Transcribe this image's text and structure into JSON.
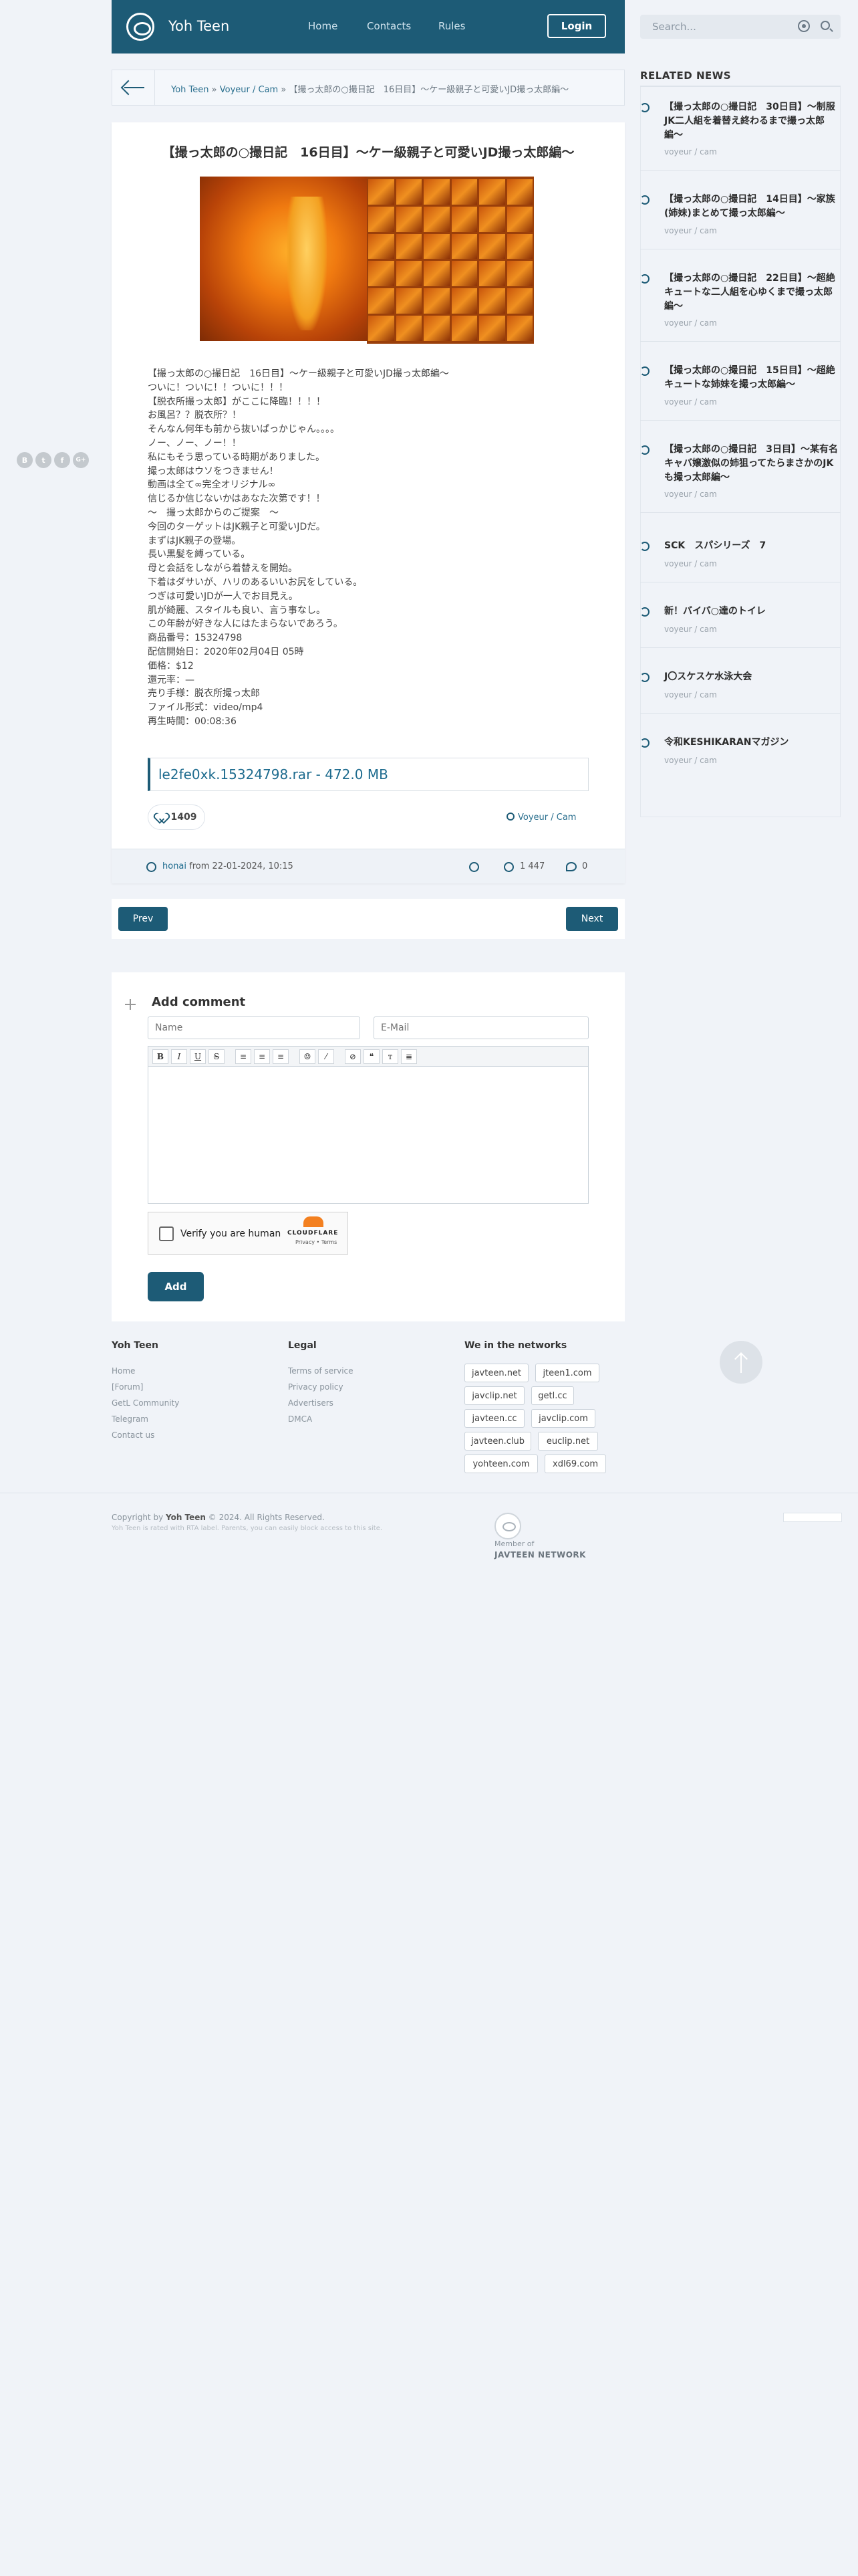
{
  "header": {
    "site_name": "Yoh Teen",
    "nav": [
      "Home",
      "Contacts",
      "Rules"
    ],
    "login": "Login",
    "search_placeholder": "Search...",
    "accent_color": "#1d5b76"
  },
  "breadcrumb": {
    "link1": "Yoh Teen",
    "sep1": " » ",
    "link2": "Voyeur / Cam",
    "sep2": " » ",
    "current": "【撮っ太郎の○撮日記　16日目】〜ケー級親子と可愛いJD撮っ太郎編〜"
  },
  "article": {
    "title": "【撮っ太郎の○撮日記　16日目】〜ケー級親子と可愛いJD撮っ太郎編〜",
    "body": "【撮っ太郎の○撮日記　16日目】〜ケー級親子と可愛いJD撮っ太郎編〜\nついに！ついに！！ついに！！！\n【脱衣所撮っ太郎】がここに降臨！！！！\nお風呂？？脱衣所？！\nそんなん何年も前から抜いぱっかじゃん。。。。\nノー、ノー、ノー！！\n私にもそう思っている時期がありました。\n撮っ太郎はウソをつきません！\n動画は全て∞完全オリジナル∞\n信じるか信じないかはあなた次第です！！\n〜　撮っ太郎からのご提案　〜\n今回のターゲットはJK親子と可愛いJDだ。\nまずはJK親子の登場。\n長い黒髪を縛っている。\n母と会話をしながら着替えを開始。\n下着はダサいが、ハリのあるいいお尻をしている。\nつぎは可愛いJDが一人でお目見え。\n肌が綺麗、スタイルも良い、言う事なし。\nこの年齢が好きな人にはたまらないであろう。\n商品番号：15324798\n配信開始日：2020年02月04日 05時\n価格：$12\n還元率：—\n売り手様：脱衣所撮っ太郎\nファイル形式：video/mp4\n再生時間：00:08:36",
    "download": "le2fe0xk.15324798.rar - 472.0 MB",
    "likes": "1409",
    "category": "Voyeur / Cam",
    "author": "honai",
    "date_text": " from 22-01-2024, 10:15",
    "views": "1 447",
    "comments": "0"
  },
  "pager": {
    "prev": "Prev",
    "next": "Next"
  },
  "comment_form": {
    "title": "Add comment",
    "name_placeholder": "Name",
    "email_placeholder": "E-Mail",
    "toolbar": [
      "B",
      "I",
      "U",
      "S",
      "≡",
      "≡",
      "≡",
      "☺",
      "⁄",
      "⊘",
      "❝",
      "ᴛ",
      "≣"
    ],
    "captcha_label": "Verify you are human",
    "captcha_brand": "CLOUDFLARE",
    "captcha_links": "Privacy • Terms",
    "submit": "Add"
  },
  "social": [
    "B",
    "t",
    "f",
    "G+"
  ],
  "sidebar": {
    "title": "RELATED NEWS",
    "items": [
      {
        "title": "【撮っ太郎の○撮日記　30日目】〜制服JK二人組を着替え終わるまで撮っ太郎編〜",
        "category": "voyeur / cam"
      },
      {
        "title": "【撮っ太郎の○撮日記　14日目】〜家族(姉妹)まとめて撮っ太郎編〜",
        "category": "voyeur / cam"
      },
      {
        "title": "【撮っ太郎の○撮日記　22日目】〜超絶キュートな二人組を心ゆくまで撮っ太郎編〜",
        "category": "voyeur / cam"
      },
      {
        "title": "【撮っ太郎の○撮日記　15日目】〜超絶キュートな姉妹を撮っ太郎編〜",
        "category": "voyeur / cam"
      },
      {
        "title": "【撮っ太郎の○撮日記　3日目】〜某有名キャバ嬢激似の姉狙ってたらまさかのJKも撮っ太郎編〜",
        "category": "voyeur / cam"
      },
      {
        "title": "SCK　スパシリーズ　7",
        "category": "voyeur / cam"
      },
      {
        "title": "新！バイバ○達のトイレ",
        "category": "voyeur / cam"
      },
      {
        "title": "J〇スケスケ水泳大会",
        "category": "voyeur / cam"
      },
      {
        "title": "令和KESHIKARANマガジン",
        "category": "voyeur / cam"
      }
    ]
  },
  "footer": {
    "col1_title": "Yoh Teen",
    "col1_links": [
      "Home",
      "[Forum]",
      "GetL Community",
      "Telegram",
      "Contact us"
    ],
    "col2_title": "Legal",
    "col2_links": [
      "Terms of service",
      "Privacy policy",
      "Advertisers",
      "DMCA"
    ],
    "col3_title": "We in the networks",
    "networks": [
      "javteen.net",
      "jteen1.com",
      "javclip.net",
      "getl.cc",
      "javteen.cc",
      "javclip.com",
      "javteen.club",
      "euclip.net",
      "yohteen.com",
      "xdl69.com"
    ],
    "copy_prefix": "Copyright by ",
    "copy_brand": "Yoh Teen",
    "copy_suffix": " © 2024. All Rights Reserved.",
    "warning": "Yoh Teen is rated with RTA label. Parents, you can easily block access to this site.",
    "member_of": "Member of",
    "network_name": "JAVTEEN NETWORK"
  }
}
